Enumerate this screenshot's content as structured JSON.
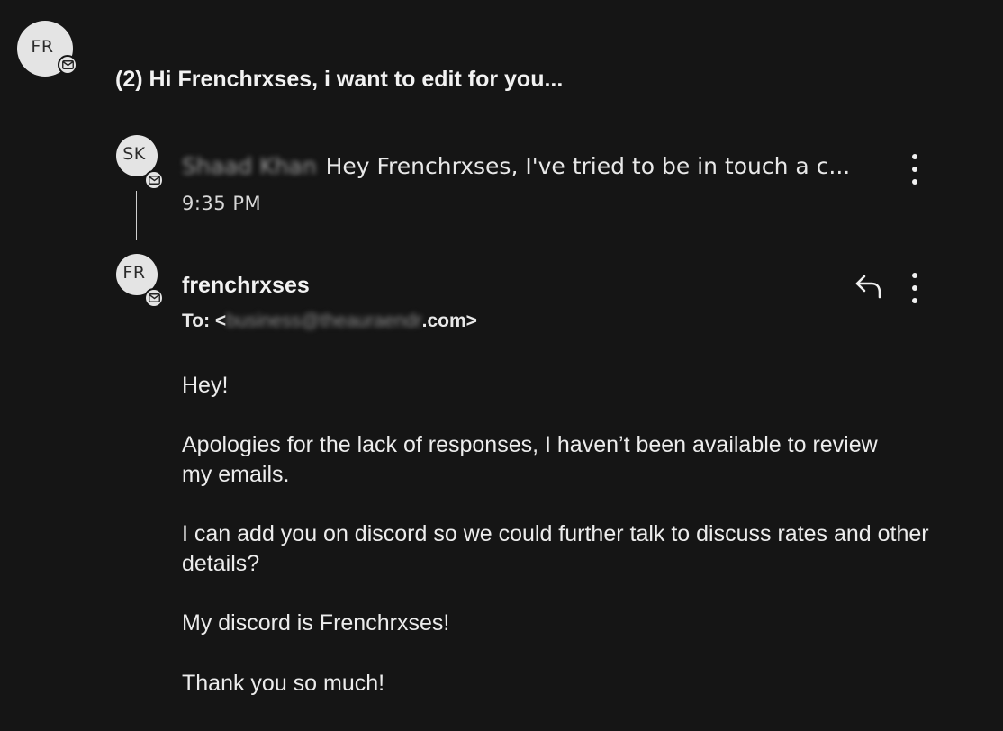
{
  "thread": {
    "title": "(2) Hi Frenchrxses, i want to edit for you...",
    "avatar_initials": "FR"
  },
  "messages": [
    {
      "avatar_initials": "SK",
      "sender_name_blurred": "Shaad Khan",
      "snippet": "Hey Frenchrxses, I've tried to be in touch a c...",
      "time": "9:35 PM"
    },
    {
      "avatar_initials": "FR",
      "sender": "frenchrxses",
      "to_label": "To: <",
      "to_address_blurred": "business@theauraendr",
      "to_address_suffix": ".com>",
      "body": [
        "Hey!",
        "Apologies for the lack of responses, I haven’t been available to review my emails.",
        "I can add you on discord so we could further talk to discuss rates and other details?",
        "My discord is Frenchrxses!",
        "Thank you so much!"
      ]
    }
  ],
  "icons": {
    "badge": "mail-icon",
    "reply": "reply-icon",
    "more": "more-vertical-icon"
  },
  "colors": {
    "background": "#151515",
    "avatar": "#e4e4e4",
    "text": "#ececec"
  }
}
